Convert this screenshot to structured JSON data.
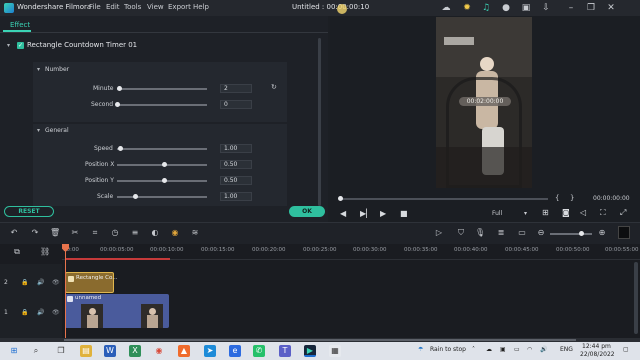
{
  "titlebar": {
    "app_name": "Wondershare Filmora",
    "menus": [
      "File",
      "Edit",
      "Tools",
      "View",
      "Export",
      "Help"
    ],
    "document_title": "Untitled : 00:00:00:10"
  },
  "effect_panel": {
    "tab_label": "Effect",
    "effect_name": "Rectangle Countdown Timer 01",
    "sections": {
      "number": {
        "title": "Number",
        "params": [
          {
            "label": "Minute",
            "value": "2",
            "slider_fraction": 0.02
          },
          {
            "label": "Second",
            "value": "0",
            "slider_fraction": 0.0
          }
        ]
      },
      "general": {
        "title": "General",
        "params": [
          {
            "label": "Speed",
            "value": "1.00",
            "slider_fraction": 0.05
          },
          {
            "label": "Position X",
            "value": "0.50",
            "slider_fraction": 0.5
          },
          {
            "label": "Position Y",
            "value": "0.50",
            "slider_fraction": 0.5
          },
          {
            "label": "Scale",
            "value": "1.00",
            "slider_fraction": 0.2
          }
        ]
      }
    },
    "reset_label": "RESET",
    "ok_label": "OK"
  },
  "preview": {
    "timer_overlay": "00:02:00:00",
    "timecode": "00:00:00:00",
    "quality": "Full"
  },
  "timeline": {
    "ruler": [
      "00:00",
      "00:00:05:00",
      "00:00:10:00",
      "00:00:15:00",
      "00:00:20:00",
      "00:00:25:00",
      "00:00:30:00",
      "00:00:35:00",
      "00:00:40:00",
      "00:00:45:00",
      "00:00:50:00",
      "00:00:55:00"
    ],
    "tracks": [
      {
        "number": "2",
        "clip_label": "Rectangle Co..."
      },
      {
        "number": "1",
        "clip_label": "unnamed"
      }
    ]
  },
  "taskbar": {
    "weather": "Rain to stop",
    "language": "ENG",
    "time": "12:44 pm",
    "date": "22/08/2022"
  },
  "colors": {
    "accent": "#2fbf9e",
    "playhead": "#e8744d",
    "title_clip": "#8a6b2e",
    "video_clip": "#4a5b9c"
  }
}
